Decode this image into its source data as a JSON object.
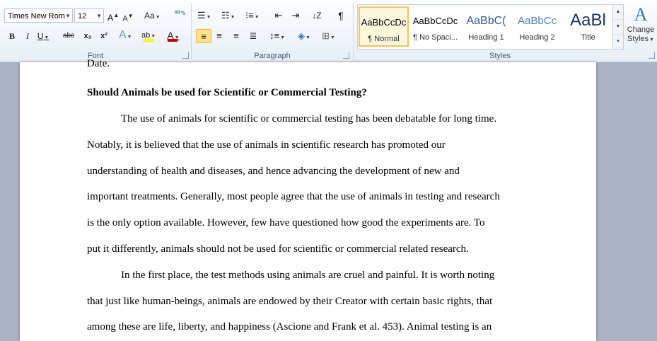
{
  "ribbon": {
    "font_group": {
      "label": "Font",
      "font_name": "Times New Rom",
      "font_size": "12",
      "grow_label": "A",
      "shrink_label": "A",
      "change_case_label": "Aa",
      "bold": "B",
      "italic": "I",
      "underline": "U",
      "strike": "abc",
      "subscript": "x₂",
      "superscript": "x²",
      "text_effects": "A",
      "highlight": "ab",
      "font_color": "A",
      "highlight_color": "#ffff00",
      "font_color_bar": "#c00000"
    },
    "paragraph_group": {
      "label": "Paragraph",
      "pilcrow": "¶"
    },
    "styles_group": {
      "label": "Styles",
      "items": [
        {
          "sample": "AaBbCcDc",
          "name": "¶ Normal",
          "color": "#000000"
        },
        {
          "sample": "AaBbCcDc",
          "name": "¶ No Spaci...",
          "color": "#000000"
        },
        {
          "sample": "AaBbC(",
          "name": "Heading 1",
          "color": "#2e5c99"
        },
        {
          "sample": "AaBbCc",
          "name": "Heading 2",
          "color": "#4f81bd"
        },
        {
          "sample": "AaBl",
          "name": "Title",
          "color": "#17365d"
        }
      ],
      "change_styles_line1": "Change",
      "change_styles_line2": "Styles"
    }
  },
  "document": {
    "lines": [
      "Date.",
      "Should Animals be used for Scientific or Commercial Testing?",
      "The use of animals for scientific or commercial  testing has been debatable for long time.",
      "Notably, it is believed that the use of animals in scientific research has promoted our",
      "understanding of health and diseases, and hence advancing the development of new and",
      "important treatments. Generally, most people agree that the use of animals in testing and research",
      "is the only option available. However, few have questioned how good the experiments are. To",
      "put it differently, animals  should not be used for scientific or commercial  related research.",
      "In the first place, the test methods using animals are cruel and painful. It is worth noting",
      "that just like human-beings, animals are endowed by their Creator with certain basic rights, that",
      "among these are life, liberty, and happiness (Ascione and Frank et al. 453). Animal testing is an"
    ]
  }
}
